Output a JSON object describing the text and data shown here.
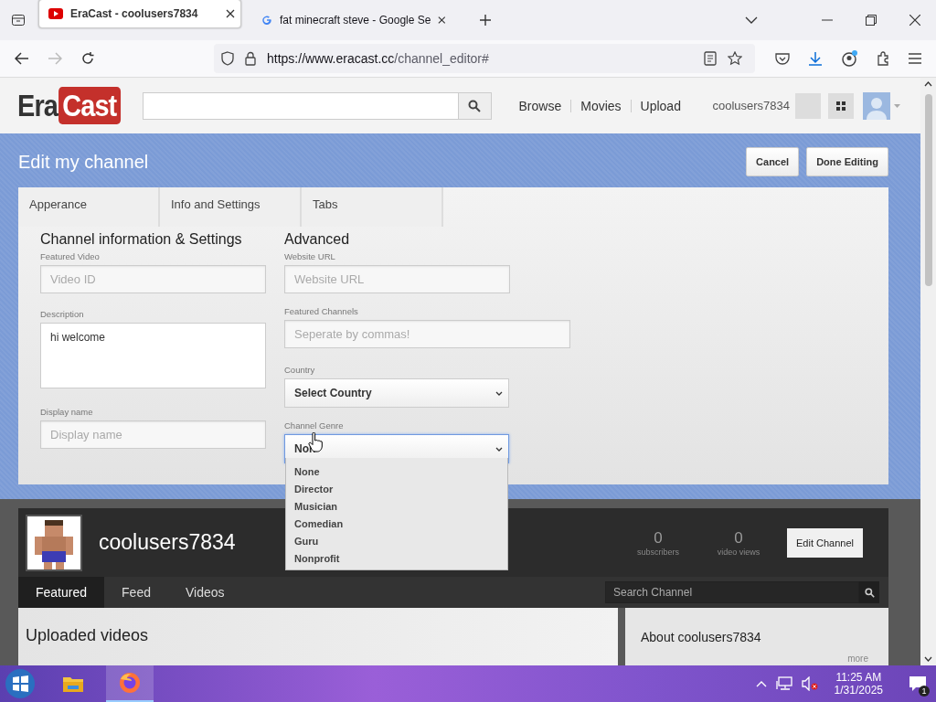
{
  "browser": {
    "tabs": [
      {
        "title": "EraCast - coolusers7834",
        "selected": true
      },
      {
        "title": "fat minecraft steve - Google Se",
        "selected": false
      }
    ],
    "url_host": "https://www.eracast.cc",
    "url_path": "/channel_editor#"
  },
  "site": {
    "logo_a": "Era",
    "logo_b": "Cast",
    "nav": [
      "Browse",
      "Movies",
      "Upload"
    ],
    "username": "coolusers7834"
  },
  "editor": {
    "title": "Edit my channel",
    "buttons": [
      "Cancel",
      "Done Editing"
    ],
    "tabs": [
      "Apperance",
      "Info and Settings",
      "Tabs"
    ],
    "left_heading": "Channel information & Settings",
    "right_heading": "Advanced",
    "left_fields": [
      {
        "label": "Featured Video",
        "kind": "input",
        "placeholder": "Video ID"
      },
      {
        "label": "Description",
        "kind": "textarea",
        "value": "hi welcome"
      },
      {
        "label": "Display name",
        "kind": "input",
        "placeholder": "Display name"
      }
    ],
    "right_fields": [
      {
        "label": "Website URL",
        "kind": "input",
        "placeholder": "Website URL"
      },
      {
        "label": "Featured Channels",
        "kind": "wide",
        "placeholder": "Seperate by commas!"
      },
      {
        "label": "Country",
        "kind": "select",
        "value": "Select Country",
        "focused": false
      },
      {
        "label": "Channel Genre",
        "kind": "select",
        "value": "Non",
        "focused": true
      }
    ],
    "genre_options": [
      "None",
      "Director",
      "Musician",
      "Comedian",
      "Guru",
      "Nonprofit"
    ]
  },
  "channel": {
    "name": "coolusers7834",
    "stats": [
      {
        "value": "0",
        "label": "subscribers"
      },
      {
        "value": "0",
        "label": "video views"
      }
    ],
    "edit_button": "Edit Channel",
    "tabs": [
      {
        "label": "Featured",
        "selected": true
      },
      {
        "label": "Feed",
        "selected": false
      },
      {
        "label": "Videos",
        "selected": false
      }
    ],
    "search_placeholder": "Search Channel",
    "uploaded_heading": "Uploaded videos",
    "about_heading": "About coolusers7834",
    "more": "more"
  },
  "taskbar": {
    "time": "11:25 AM",
    "date": "1/31/2025",
    "notifications": "1"
  }
}
